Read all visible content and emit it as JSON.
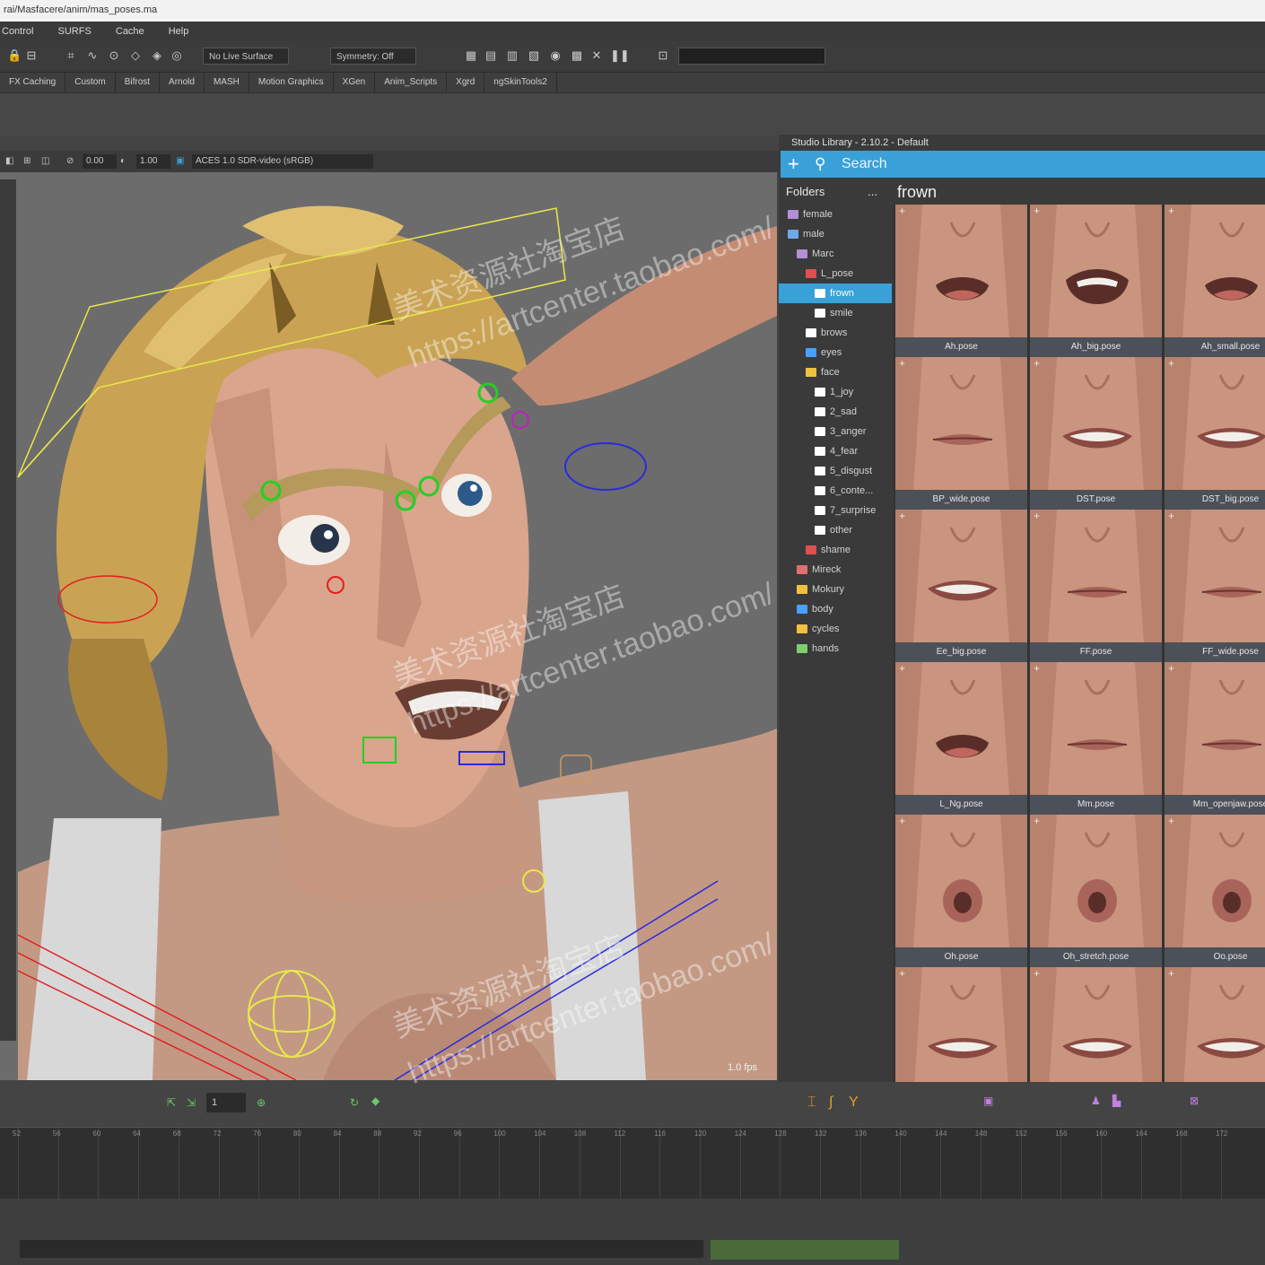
{
  "titlebar": {
    "path": "rai/Masfacere/anim/mas_poses.ma"
  },
  "menu": [
    "Control",
    "SURFS",
    "Cache",
    "Help"
  ],
  "toolbar": {
    "live_surface": "No Live Surface",
    "symmetry": "Symmetry: Off"
  },
  "shelf_tabs": [
    "FX Caching",
    "Custom",
    "Bifrost",
    "Arnold",
    "MASH",
    "Motion Graphics",
    "XGen",
    "Anim_Scripts",
    "Xgrd",
    "ngSkinTools2"
  ],
  "viewport": {
    "toolbar": {
      "field_a": "0.00",
      "field_b": "1.00",
      "colorspace": "ACES 1.0 SDR-video (sRGB)"
    },
    "fps": "1.0 fps"
  },
  "studio_library": {
    "title": "Studio Library - 2.10.2 - Default",
    "search_placeholder": "Search",
    "folders_label": "Folders",
    "folders_more": "...",
    "current_folder": "frown",
    "tree": [
      {
        "label": "female",
        "indent": 1,
        "color": "#b38fd6",
        "selected": false
      },
      {
        "label": "male",
        "indent": 1,
        "color": "#6fa8e8",
        "selected": false
      },
      {
        "label": "Marc",
        "indent": 2,
        "color": "#b38fd6",
        "selected": false
      },
      {
        "label": "L_pose",
        "indent": 3,
        "color": "#e05050",
        "selected": false
      },
      {
        "label": "frown",
        "indent": 4,
        "color": "#ffffff",
        "selected": true
      },
      {
        "label": "smile",
        "indent": 4,
        "color": "#ffffff",
        "selected": false
      },
      {
        "label": "brows",
        "indent": 3,
        "color": "#ffffff",
        "selected": false
      },
      {
        "label": "eyes",
        "indent": 3,
        "color": "#4aa0ff",
        "selected": false
      },
      {
        "label": "face",
        "indent": 3,
        "color": "#f0c040",
        "selected": false
      },
      {
        "label": "1_joy",
        "indent": 4,
        "color": "#ffffff",
        "selected": false
      },
      {
        "label": "2_sad",
        "indent": 4,
        "color": "#ffffff",
        "selected": false
      },
      {
        "label": "3_anger",
        "indent": 4,
        "color": "#ffffff",
        "selected": false
      },
      {
        "label": "4_fear",
        "indent": 4,
        "color": "#ffffff",
        "selected": false
      },
      {
        "label": "5_disgust",
        "indent": 4,
        "color": "#ffffff",
        "selected": false
      },
      {
        "label": "6_conte...",
        "indent": 4,
        "color": "#ffffff",
        "selected": false
      },
      {
        "label": "7_surprise",
        "indent": 4,
        "color": "#ffffff",
        "selected": false
      },
      {
        "label": "other",
        "indent": 4,
        "color": "#ffffff",
        "selected": false
      },
      {
        "label": "shame",
        "indent": 3,
        "color": "#e05050",
        "selected": false
      },
      {
        "label": "Mireck",
        "indent": 2,
        "color": "#e07070",
        "selected": false
      },
      {
        "label": "Mokury",
        "indent": 2,
        "color": "#f0c040",
        "selected": false
      },
      {
        "label": "body",
        "indent": 2,
        "color": "#4aa0ff",
        "selected": false
      },
      {
        "label": "cycles",
        "indent": 2,
        "color": "#f0c040",
        "selected": false
      },
      {
        "label": "hands",
        "indent": 2,
        "color": "#7cd06a",
        "selected": false
      }
    ],
    "poses": [
      {
        "label": "Ah.pose",
        "mouth": "open"
      },
      {
        "label": "Ah_big.pose",
        "mouth": "wide"
      },
      {
        "label": "Ah_small.pose",
        "mouth": "open"
      },
      {
        "label": "BP_wide.pose",
        "mouth": "closed"
      },
      {
        "label": "DST.pose",
        "mouth": "teeth"
      },
      {
        "label": "DST_big.pose",
        "mouth": "teeth"
      },
      {
        "label": "Ee_big.pose",
        "mouth": "teeth"
      },
      {
        "label": "FF.pose",
        "mouth": "closed"
      },
      {
        "label": "FF_wide.pose",
        "mouth": "closed"
      },
      {
        "label": "L_Ng.pose",
        "mouth": "open"
      },
      {
        "label": "Mm.pose",
        "mouth": "closed"
      },
      {
        "label": "Mm_openjaw.pose",
        "mouth": "closed"
      },
      {
        "label": "Oh.pose",
        "mouth": "round"
      },
      {
        "label": "Oh_stretch.pose",
        "mouth": "round"
      },
      {
        "label": "Oo.pose",
        "mouth": "round"
      },
      {
        "label": "",
        "mouth": "teeth"
      },
      {
        "label": "",
        "mouth": "teeth"
      },
      {
        "label": "",
        "mouth": "teeth"
      }
    ]
  },
  "timeline": {
    "current_frame": "1",
    "ticks": [
      "52",
      "56",
      "60",
      "64",
      "68",
      "72",
      "76",
      "80",
      "84",
      "88",
      "92",
      "96",
      "100",
      "104",
      "108",
      "112",
      "116",
      "120",
      "124",
      "128",
      "132",
      "136",
      "140",
      "144",
      "148",
      "152",
      "156",
      "160",
      "164",
      "168",
      "172"
    ]
  },
  "watermarks": [
    "美术资源社淘宝店",
    "https://artcenter.taobao.com/"
  ],
  "colors": {
    "accent": "#3aa0d8",
    "viewport_bg": "#6c6c6c",
    "panel_bg": "#3a3a3a"
  }
}
